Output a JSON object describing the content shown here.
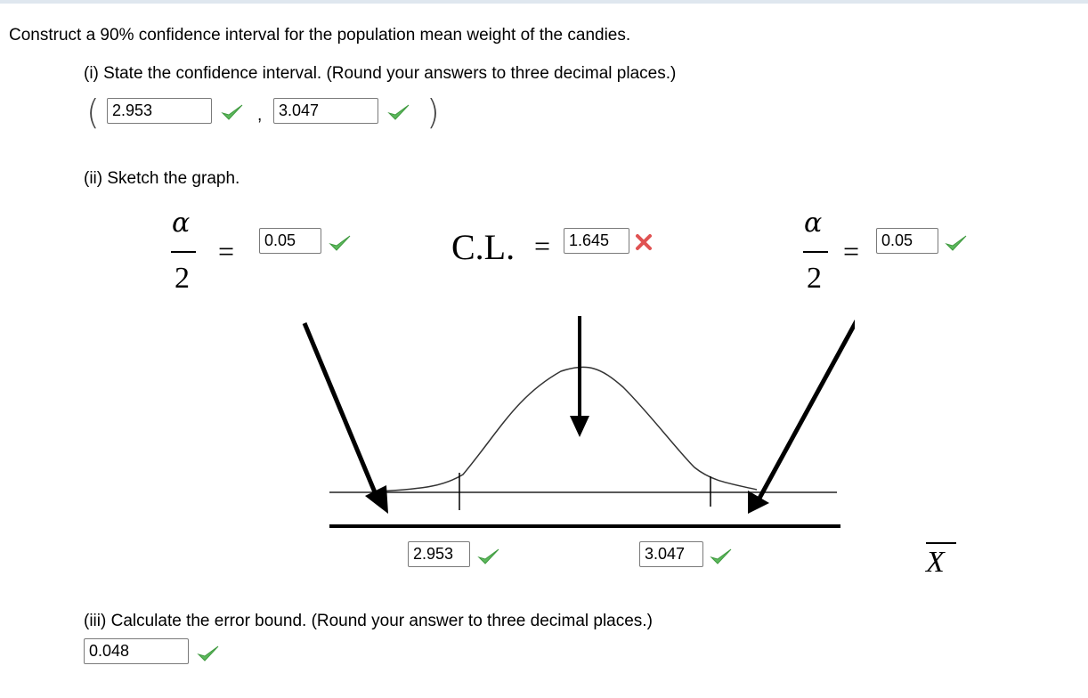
{
  "question": {
    "prompt": "Construct a 90% confidence interval for the population mean weight of the candies.",
    "part_i": {
      "label": "(i) State the confidence interval. (Round your answers to three decimal places.)",
      "open_paren": "(",
      "separator": ",",
      "close_paren": ")",
      "lower_value": "2.953",
      "upper_value": "3.047"
    },
    "part_ii": {
      "label": "(ii) Sketch the graph.",
      "alpha_symbol": "α",
      "denominator": "2",
      "equals": "=",
      "left_tail_value": "0.05",
      "right_tail_value": "0.05",
      "cl_label": "C.L.",
      "cl_equals": "=",
      "cl_value": "1.645",
      "axis_left_value": "2.953",
      "axis_right_value": "3.047",
      "axis_variable": "X"
    },
    "part_iii": {
      "label": "(iii) Calculate the error bound. (Round your answer to three decimal places.)",
      "value": "0.048"
    }
  },
  "status": {
    "correct_color": "#5cb85c",
    "incorrect_color": "#e05252"
  }
}
